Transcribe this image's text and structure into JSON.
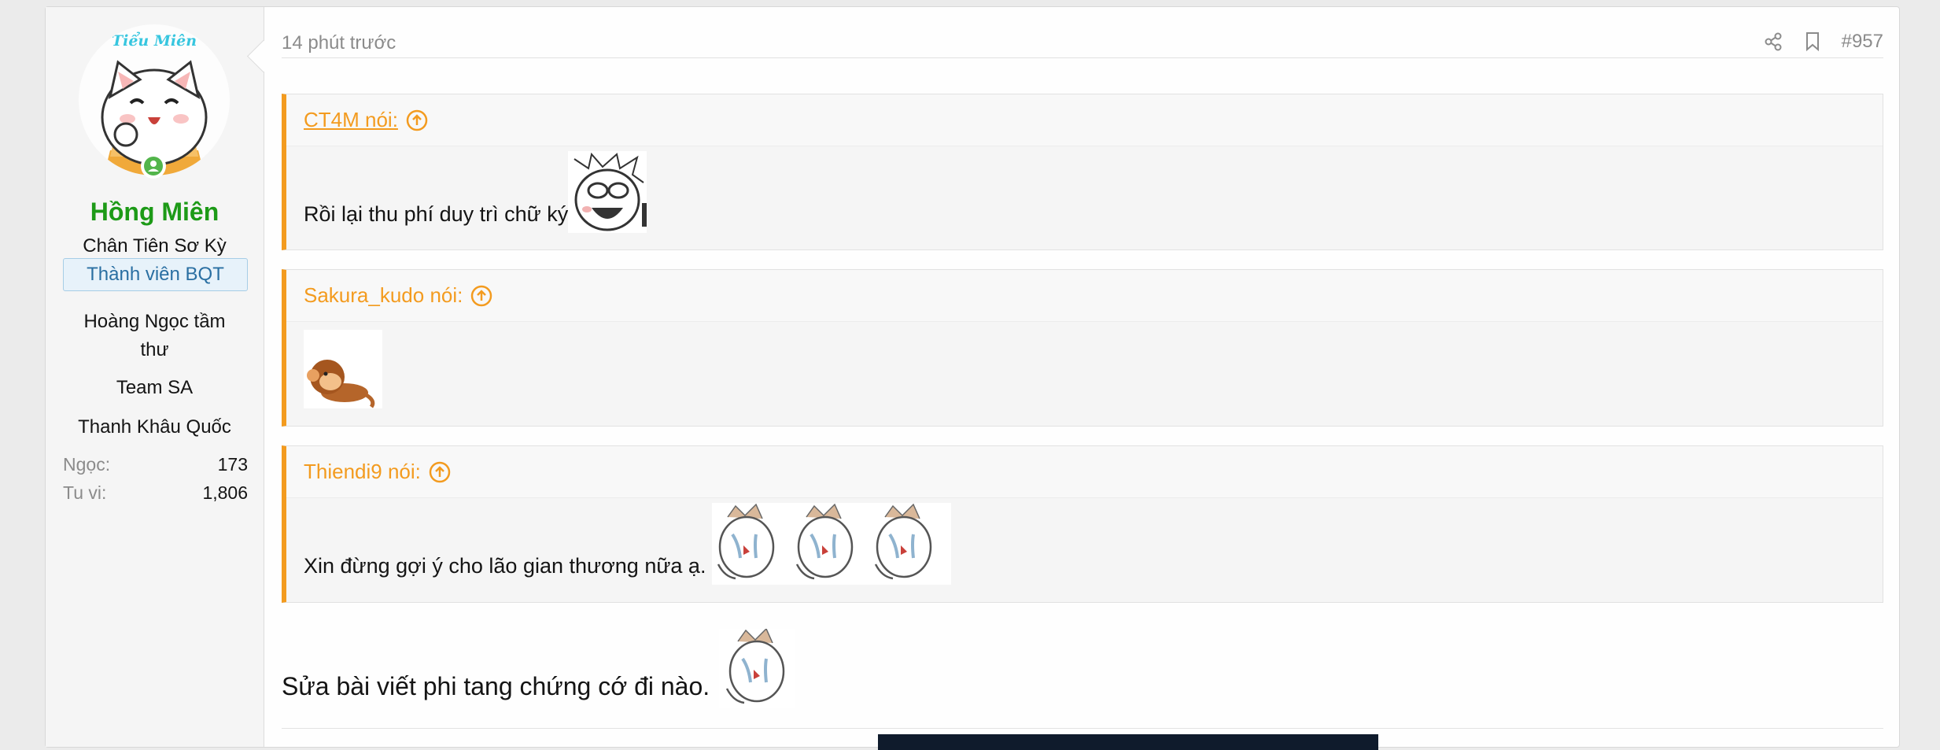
{
  "user": {
    "avatar_logo": "Tiểu Miên",
    "name": "Hồng Miên",
    "title": "Chân Tiên Sơ Kỳ",
    "banner": "Thành viên BQT",
    "extras": [
      "Hoàng Ngọc tầm thư",
      "Team SA",
      "Thanh Khâu Quốc"
    ],
    "stats": [
      {
        "label": "Ngọc:",
        "value": "173"
      },
      {
        "label": "Tu vi:",
        "value": "1,806"
      }
    ]
  },
  "post": {
    "time": "14 phút trước",
    "number": "#957",
    "share_icon": "share-icon",
    "bookmark_icon": "bookmark-icon"
  },
  "quotes": [
    {
      "author": "CT4M nói:",
      "text": "Rồi lại thu phí duy trì chữ ký"
    },
    {
      "author": "Sakura_kudo nói:",
      "text": ""
    },
    {
      "author": "Thiendi9 nói:",
      "text": "Xin đừng gợi ý cho lão gian thương nữa ạ."
    }
  ],
  "message": "Sửa bài viết phi tang chứng cớ đi nào.",
  "colors": {
    "accent": "#f39b1f",
    "username": "#1d9a17",
    "banner": "#2a6fa2"
  }
}
